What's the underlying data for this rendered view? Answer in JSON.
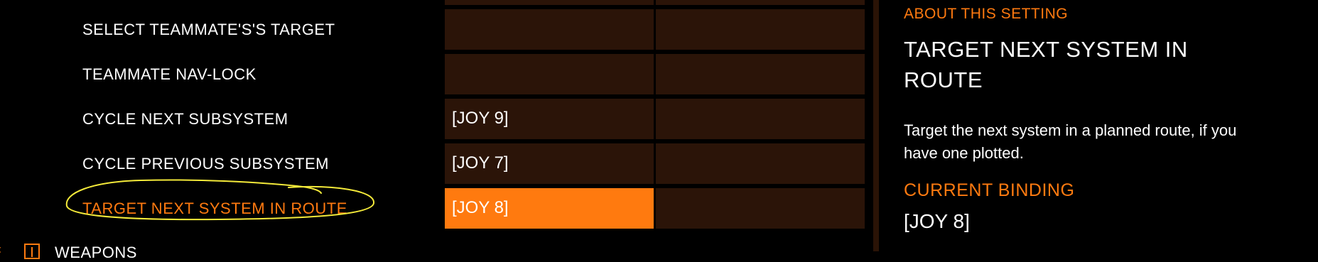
{
  "rows": [
    {
      "label": "SELECT TEAMMATE'S'S TARGET",
      "primary": "",
      "secondary": ""
    },
    {
      "label": "TEAMMATE NAV-LOCK",
      "primary": "",
      "secondary": ""
    },
    {
      "label": "CYCLE NEXT SUBSYSTEM",
      "primary": "[JOY 9]",
      "secondary": ""
    },
    {
      "label": "CYCLE PREVIOUS SUBSYSTEM",
      "primary": "[JOY 7]",
      "secondary": ""
    },
    {
      "label": "TARGET NEXT SYSTEM IN ROUTE",
      "primary": "[JOY 8]",
      "secondary": ""
    }
  ],
  "next_section": {
    "label": "WEAPONS",
    "icon": "expand-toggle-icon"
  },
  "about": {
    "heading": "ABOUT THIS SETTING",
    "title": "TARGET NEXT SYSTEM IN ROUTE",
    "description": "Target the next system in a planned route, if you have one plotted.",
    "binding_heading": "CURRENT BINDING",
    "binding_value": "[JOY 8]"
  },
  "colors": {
    "accent": "#ff7a10",
    "cell_bg": "#2b1408",
    "active_cell": "#ff7a0f",
    "annotation": "#f4ea3a"
  }
}
